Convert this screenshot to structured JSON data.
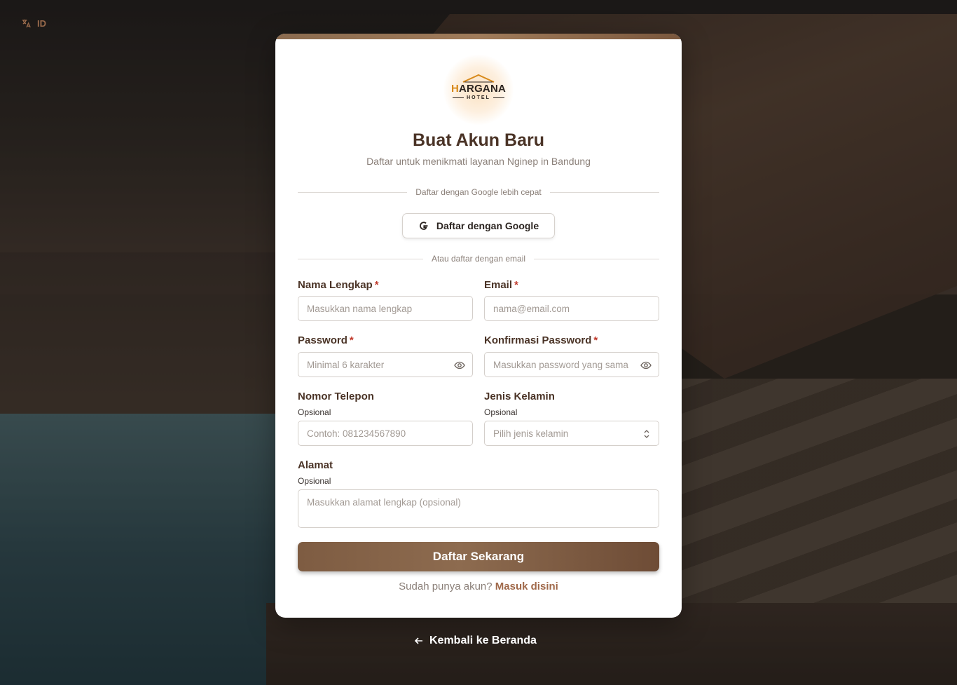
{
  "language": {
    "code": "ID",
    "icon": "translate-icon"
  },
  "logo": {
    "brand_initial": "H",
    "brand_rest": "ARGANA",
    "sub": "HOTEL"
  },
  "header": {
    "title": "Buat Akun Baru",
    "subtitle": "Daftar untuk menikmati layanan Nginep in Bandung"
  },
  "google": {
    "divider": "Daftar dengan Google lebih cepat",
    "button_label": "Daftar dengan Google"
  },
  "email_divider": "Atau daftar dengan email",
  "form": {
    "full_name": {
      "label": "Nama Lengkap",
      "required": "*",
      "placeholder": "Masukkan nama lengkap"
    },
    "email": {
      "label": "Email",
      "required": "*",
      "placeholder": "nama@email.com"
    },
    "password": {
      "label": "Password",
      "required": "*",
      "placeholder": "Minimal 6 karakter"
    },
    "confirm_password": {
      "label": "Konfirmasi Password",
      "required": "*",
      "placeholder": "Masukkan password yang sama"
    },
    "phone": {
      "label": "Nomor Telepon",
      "hint": "Opsional",
      "placeholder": "Contoh: 081234567890"
    },
    "gender": {
      "label": "Jenis Kelamin",
      "hint": "Opsional",
      "placeholder": "Pilih jenis kelamin"
    },
    "address": {
      "label": "Alamat",
      "hint": "Opsional",
      "placeholder": "Masukkan alamat lengkap (opsional)"
    }
  },
  "submit_label": "Daftar Sekarang",
  "login_prompt": {
    "text": "Sudah punya akun?",
    "link": "Masuk disini"
  },
  "back_link": "Kembali ke Beranda",
  "colors": {
    "brand_brown": "#7e5c42",
    "title": "#4a3326",
    "link": "#a0694a",
    "required": "#c0392b",
    "logo_accent": "#d88a1b"
  }
}
